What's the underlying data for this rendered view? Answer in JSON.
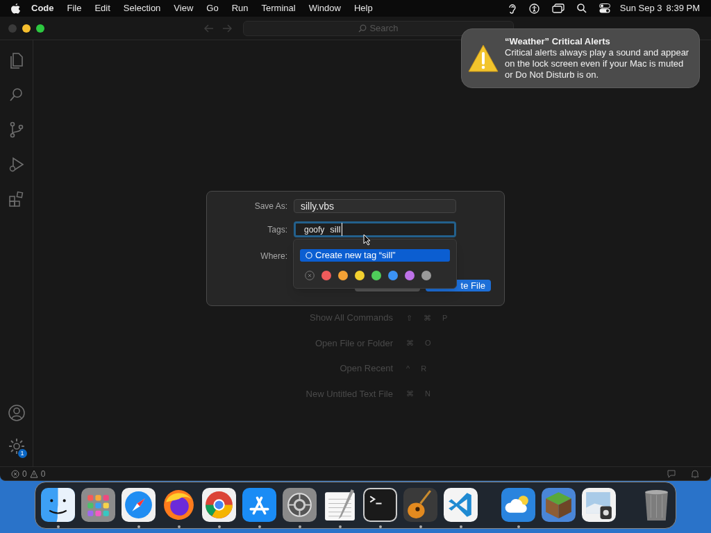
{
  "menu_bar": {
    "app_name": "Code",
    "items": [
      "File",
      "Edit",
      "Selection",
      "View",
      "Go",
      "Run",
      "Terminal",
      "Window",
      "Help"
    ],
    "date": "Sun Sep 3",
    "time": "8:39 PM"
  },
  "title_bar": {
    "search": {
      "placeholder": "Search"
    }
  },
  "activity_bar": {
    "top": [
      {
        "kind": "files"
      },
      {
        "kind": "search"
      },
      {
        "kind": "source-control"
      },
      {
        "kind": "run"
      },
      {
        "kind": "extensions"
      }
    ],
    "bottom": [
      {
        "kind": "account"
      },
      {
        "kind": "settings",
        "badge": "1"
      }
    ]
  },
  "welcome": {
    "commands": [
      {
        "label": "Show All Commands",
        "keys": [
          "⇧",
          "⌘",
          "P"
        ]
      },
      {
        "label": "Open File or Folder",
        "keys": [
          "⌘",
          "O"
        ]
      },
      {
        "label": "Open Recent",
        "keys": [
          "^",
          "R"
        ]
      },
      {
        "label": "New Untitled Text File",
        "keys": [
          "⌘",
          "N"
        ]
      }
    ]
  },
  "status_bar": {
    "errors": "0",
    "warnings": "0"
  },
  "save_dialog": {
    "save_as": {
      "label": "Save As:",
      "value": "silly.vbs"
    },
    "tags": {
      "label": "Tags:",
      "tokens": [
        "goofy"
      ],
      "value": "sill"
    },
    "where": {
      "label": "Where:"
    },
    "buttons": [
      {
        "kind": "cancel"
      },
      {
        "kind": "default",
        "label": "te File"
      }
    ],
    "tag_popover": {
      "suggestion": {
        "label": "Create new tag “sill”",
        "selected": true
      },
      "colors": [
        {
          "kind": "none"
        },
        {
          "kind": "color",
          "color": "#ef5b5b"
        },
        {
          "kind": "color",
          "color": "#f4a235"
        },
        {
          "kind": "color",
          "color": "#f2d02f"
        },
        {
          "kind": "color",
          "color": "#4fcd5a"
        },
        {
          "kind": "color",
          "color": "#3b93f5"
        },
        {
          "kind": "color",
          "color": "#be72e8"
        },
        {
          "kind": "color",
          "color": "#9a9a9a"
        }
      ]
    }
  },
  "notification": {
    "title": "“Weather” Critical Alerts",
    "body": "Critical alerts always play a sound and appear on the lock screen even if your Mac is muted or Do Not Disturb is on."
  },
  "dock": {
    "items": [
      {
        "kind": "finder",
        "running": true
      },
      {
        "kind": "launchpad",
        "running": false
      },
      {
        "kind": "safari",
        "running": true
      },
      {
        "kind": "firefox",
        "running": true
      },
      {
        "kind": "chrome",
        "running": true
      },
      {
        "kind": "appstore",
        "running": true
      },
      {
        "kind": "settings",
        "running": true
      },
      {
        "kind": "textedit",
        "running": true
      },
      {
        "kind": "terminal",
        "running": true
      },
      {
        "kind": "guitar",
        "running": true
      },
      {
        "kind": "vscode",
        "running": true
      },
      {
        "kind": "separator"
      },
      {
        "kind": "weather",
        "running": true
      },
      {
        "kind": "grass-block",
        "running": false
      },
      {
        "kind": "preview",
        "running": false
      },
      {
        "kind": "separator"
      },
      {
        "kind": "trash",
        "running": false
      }
    ]
  }
}
